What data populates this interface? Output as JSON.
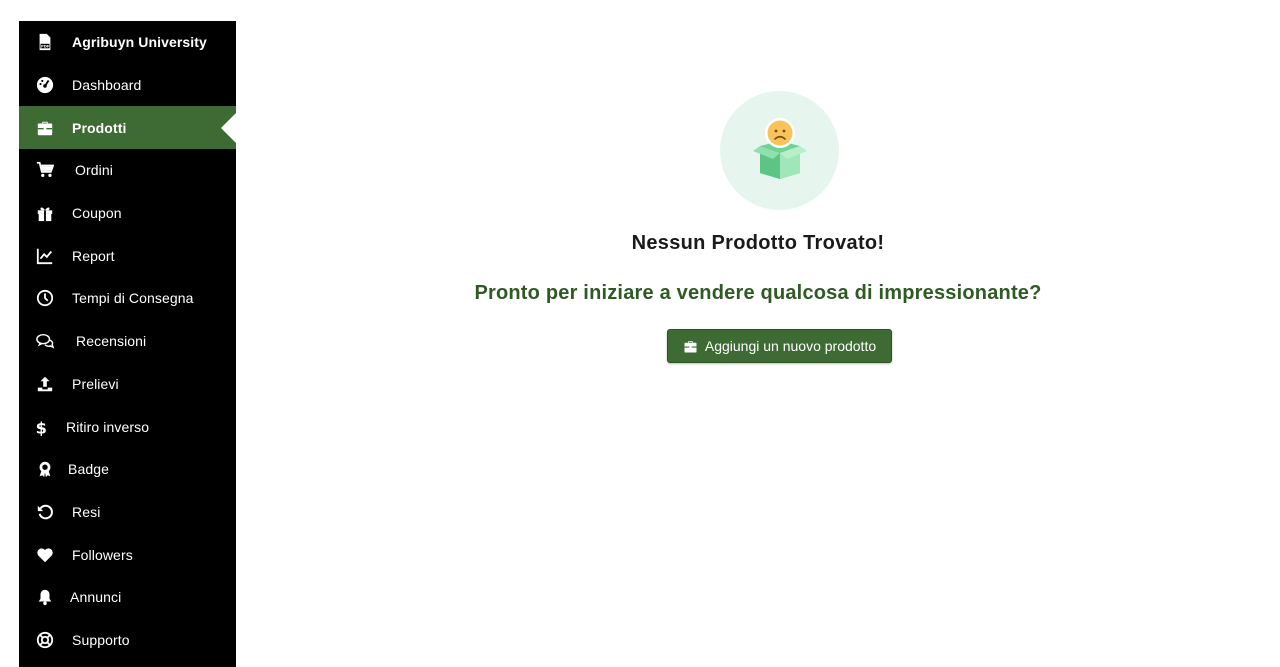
{
  "sidebar": {
    "brand": {
      "label": "Agribuyn University",
      "icon": "pdf-file-icon"
    },
    "items": [
      {
        "label": "Dashboard",
        "icon": "dashboard-icon"
      },
      {
        "label": "Prodotti",
        "icon": "briefcase-icon",
        "active": true
      },
      {
        "label": "Ordini",
        "icon": "cart-icon"
      },
      {
        "label": "Coupon",
        "icon": "gift-icon"
      },
      {
        "label": "Report",
        "icon": "chart-line-icon"
      },
      {
        "label": "Tempi di Consegna",
        "icon": "clock-icon"
      },
      {
        "label": "Recensioni",
        "icon": "comments-icon"
      },
      {
        "label": "Prelievi",
        "icon": "upload-icon"
      },
      {
        "label": "Ritiro inverso",
        "icon": "dollar-icon"
      },
      {
        "label": "Badge",
        "icon": "award-icon"
      },
      {
        "label": "Resi",
        "icon": "undo-icon"
      },
      {
        "label": "Followers",
        "icon": "heart-icon"
      },
      {
        "label": "Annunci",
        "icon": "bell-icon"
      },
      {
        "label": "Supporto",
        "icon": "lifebuoy-icon"
      }
    ]
  },
  "main": {
    "empty_title": "Nessun Prodotto Trovato!",
    "empty_subtitle": "Pronto per iniziare a vendere qualcosa di impressionante?",
    "add_button_label": "Aggiungi un nuovo prodotto"
  },
  "colors": {
    "sidebar_bg": "#000000",
    "accent": "#3d6b33",
    "subtitle": "#2f5a24",
    "illustration_bg": "#e6f6ef"
  }
}
